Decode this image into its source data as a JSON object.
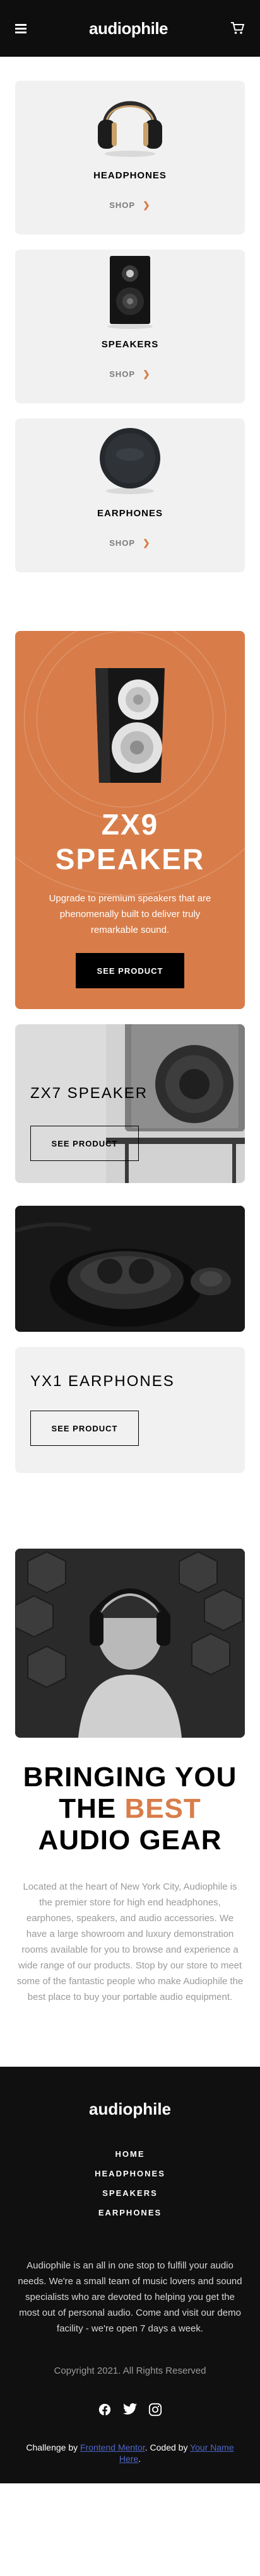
{
  "header": {
    "logo": "audiophile",
    "menu_icon": "hamburger-icon",
    "cart_icon": "cart-icon"
  },
  "categories": [
    {
      "title": "HEADPHONES",
      "shop_label": "SHOP",
      "icon": "headphones-image"
    },
    {
      "title": "SPEAKERS",
      "shop_label": "SHOP",
      "icon": "speaker-image"
    },
    {
      "title": "EARPHONES",
      "shop_label": "SHOP",
      "icon": "earphones-image"
    }
  ],
  "zx9": {
    "title_line1": "ZX9",
    "title_line2": "SPEAKER",
    "description": "Upgrade to premium speakers that are phenomenally built to deliver truly remarkable sound.",
    "button_label": "SEE PRODUCT"
  },
  "zx7": {
    "title": "ZX7 SPEAKER",
    "button_label": "SEE PRODUCT"
  },
  "yx1": {
    "title": "YX1 EARPHONES",
    "button_label": "SEE PRODUCT"
  },
  "about": {
    "title_line1": "BRINGING YOU",
    "title_the": "THE",
    "title_accent": "BEST",
    "title_line3": "AUDIO GEAR",
    "text": "Located at the heart of New York City, Audiophile is the premier store for high end headphones, earphones, speakers, and audio accessories. We have a large showroom and luxury demonstration rooms available for you to browse and experience a wide range of our products. Stop by our store to meet some of the fantastic people who make Audiophile the best place to buy your portable audio equipment."
  },
  "footer": {
    "logo": "audiophile",
    "nav": [
      "HOME",
      "HEADPHONES",
      "SPEAKERS",
      "EARPHONES"
    ],
    "description": "Audiophile is an all in one stop to fulfill your audio needs. We're a small team of music lovers and sound specialists who are devoted to helping you get the most out of personal audio. Come and visit our demo facility - we're open 7 days a week.",
    "copyright": "Copyright 2021. All Rights Reserved",
    "socials": [
      "facebook-icon",
      "twitter-icon",
      "instagram-icon"
    ],
    "credit_prefix": "Challenge by ",
    "credit_link1": "Frontend Mentor",
    "credit_mid": ". Coded by ",
    "credit_link2": "Your Name Here",
    "credit_suffix": "."
  },
  "colors": {
    "accent": "#d87d4a",
    "dark": "#101010",
    "light_gray": "#f1f1f1",
    "link": "#4d65c8"
  }
}
